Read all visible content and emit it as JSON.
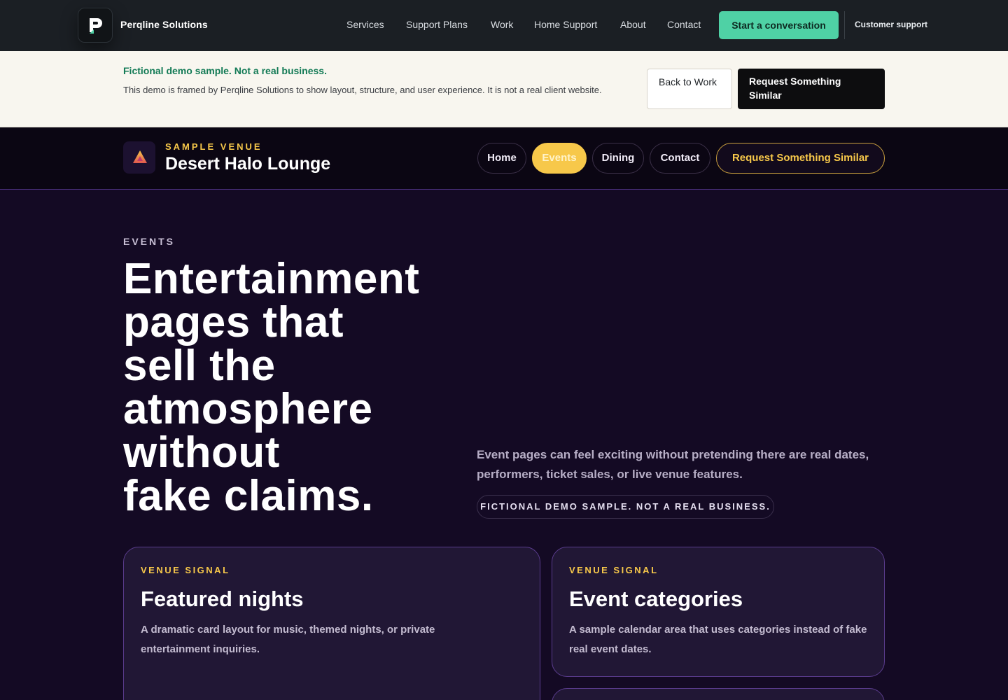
{
  "site": {
    "brand": "Perqline Solutions",
    "nav": [
      "Services",
      "Support Plans",
      "Work",
      "Home Support",
      "About",
      "Contact"
    ],
    "cta": "Start a conversation",
    "support": "Customer support",
    "icons": {
      "logo": "perqline-p-logo-icon"
    },
    "colors": {
      "header_bg": "#1b1f24",
      "accent": "#4fd1a5"
    }
  },
  "notice": {
    "title": "Fictional demo sample. Not a real business.",
    "text": "This demo is framed by Perqline Solutions to show layout, structure, and user experience. It is not a real client website.",
    "back_label": "Back to Work",
    "request_label": "Request Something Similar"
  },
  "venue": {
    "kicker": "SAMPLE VENUE",
    "name": "Desert Halo Lounge",
    "icons": {
      "logo": "triangle-halo-icon"
    },
    "nav": {
      "home": "Home",
      "events": "Events",
      "dining": "Dining",
      "contact": "Contact",
      "request": "Request Something Similar"
    },
    "colors": {
      "gold": "#f7c84a",
      "bg": "#140a24"
    }
  },
  "hero": {
    "kicker": "EVENTS",
    "title_lines": [
      "Entertainment",
      "pages that",
      "sell the",
      "atmosphere",
      "without",
      "fake claims."
    ],
    "subtitle": "Event pages can feel exciting without pretending there are real dates, performers, ticket sales, or live venue features.",
    "badge": "FICTIONAL DEMO SAMPLE. NOT A REAL BUSINESS."
  },
  "cards": [
    {
      "kicker": "VENUE SIGNAL",
      "title": "Featured nights",
      "text": "A dramatic card layout for music, themed nights, or private entertainment inquiries."
    },
    {
      "kicker": "VENUE SIGNAL",
      "title": "Event categories",
      "text": "A sample calendar area that uses categories instead of fake real event dates."
    }
  ]
}
